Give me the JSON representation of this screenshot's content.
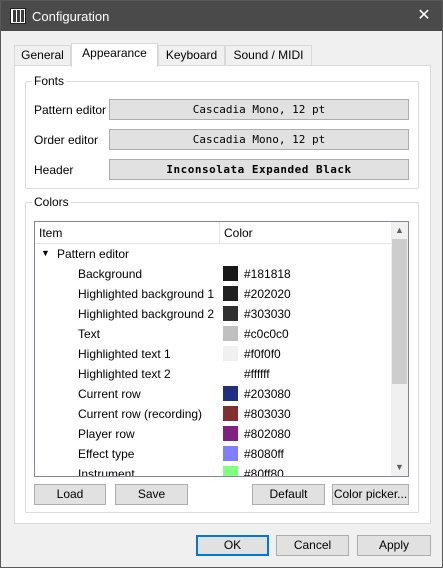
{
  "window": {
    "title": "Configuration",
    "close_glyph": "✕",
    "icon": "piano-icon"
  },
  "tabs": [
    {
      "label": "General",
      "active": false
    },
    {
      "label": "Appearance",
      "active": true
    },
    {
      "label": "Keyboard",
      "active": false
    },
    {
      "label": "Sound / MIDI",
      "active": false
    }
  ],
  "fonts": {
    "title": "Fonts",
    "rows": [
      {
        "label": "Pattern editor",
        "value": "Cascadia Mono, 12 pt"
      },
      {
        "label": "Order editor",
        "value": "Cascadia Mono, 12 pt"
      },
      {
        "label": "Header",
        "value": "Inconsolata Expanded Black"
      }
    ]
  },
  "colors": {
    "title": "Colors",
    "columns": {
      "item": "Item",
      "color": "Color"
    },
    "group": {
      "label": "Pattern editor",
      "chevron": "⌄"
    },
    "items": [
      {
        "name": "Background",
        "hex": "#181818"
      },
      {
        "name": "Highlighted background 1",
        "hex": "#202020"
      },
      {
        "name": "Highlighted background 2",
        "hex": "#303030"
      },
      {
        "name": "Text",
        "hex": "#c0c0c0"
      },
      {
        "name": "Highlighted text 1",
        "hex": "#f0f0f0"
      },
      {
        "name": "Highlighted text 2",
        "hex": "#ffffff"
      },
      {
        "name": "Current row",
        "hex": "#203080"
      },
      {
        "name": "Current row (recording)",
        "hex": "#803030"
      },
      {
        "name": "Player row",
        "hex": "#802080"
      },
      {
        "name": "Effect type",
        "hex": "#8080ff"
      },
      {
        "name": "Instrument",
        "hex": "#80ff80"
      }
    ],
    "scroll_up": "▲",
    "scroll_down": "▼"
  },
  "color_buttons": {
    "load": "Load",
    "save": "Save",
    "default": "Default",
    "picker": "Color picker..."
  },
  "dialog_buttons": {
    "ok": "OK",
    "cancel": "Cancel",
    "apply": "Apply"
  }
}
